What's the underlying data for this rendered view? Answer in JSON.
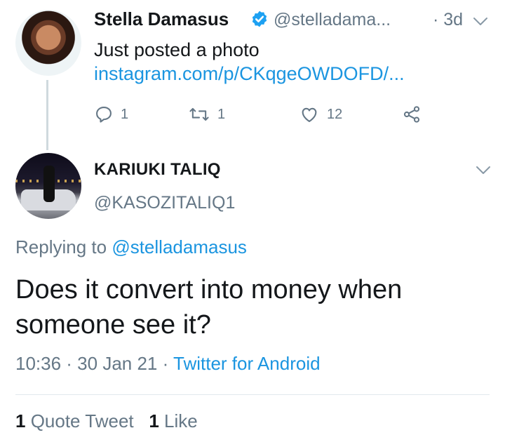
{
  "original_tweet": {
    "author_name": "Stella Damasus",
    "handle": "@stelladama...",
    "time": "· 3d",
    "text": "Just posted a photo ",
    "link": "instagram.com/p/CKqgeOWDOFD/...",
    "reply_count": "1",
    "retweet_count": "1",
    "like_count": "12",
    "icons": [
      "verified-badge-icon",
      "chevron-down-icon",
      "reply-icon",
      "retweet-icon",
      "like-icon",
      "share-icon"
    ]
  },
  "reply_tweet": {
    "author_name": "KARIUKI TALIQ",
    "handle": "@KASOZITALIQ1",
    "replying_prefix": "Replying to ",
    "replying_handle": "@stelladamasus",
    "text": "Does it convert into money when someone see it?",
    "time": "10:36 · 30 Jan 21 · ",
    "source": "Twitter for Android",
    "quote_count": "1",
    "quote_label": " Quote Tweet",
    "like_count": "1",
    "like_label": " Like"
  },
  "colors": {
    "link": "#1b95e0",
    "secondary_text": "#657786",
    "primary_text": "#14171a",
    "verified": "#1da1f2"
  }
}
